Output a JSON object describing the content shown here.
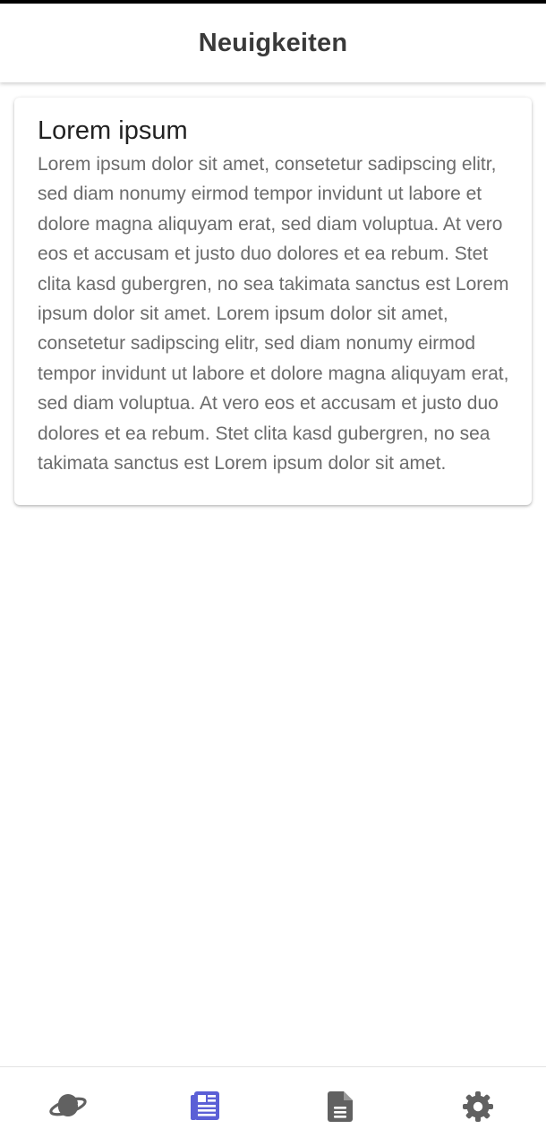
{
  "header": {
    "title": "Neuigkeiten"
  },
  "news": {
    "items": [
      {
        "title": "Lorem ipsum",
        "body": "Lorem ipsum dolor sit amet, consetetur sadipscing elitr, sed diam nonumy eirmod tempor invidunt ut labore et dolore magna aliquyam erat, sed diam voluptua. At vero eos et accusam et justo duo dolores et ea rebum. Stet clita kasd gubergren, no sea takimata sanctus est Lorem ipsum dolor sit amet. Lorem ipsum dolor sit amet, consetetur sadipscing elitr, sed diam nonumy eirmod tempor invidunt ut labore et dolore magna aliquyam erat, sed diam voluptua. At vero eos et accusam et justo duo dolores et ea rebum. Stet clita kasd gubergren, no sea takimata sanctus est Lorem ipsum dolor sit amet."
      }
    ]
  },
  "bottom_nav": {
    "items": [
      {
        "icon": "planet-icon",
        "active": false
      },
      {
        "icon": "newspaper-icon",
        "active": true
      },
      {
        "icon": "document-icon",
        "active": false
      },
      {
        "icon": "gear-icon",
        "active": false
      }
    ]
  },
  "colors": {
    "accent": "#5b5fd6",
    "icon_inactive": "#616161",
    "title_text": "#3a3a3a",
    "body_text": "#6b6b6b"
  }
}
